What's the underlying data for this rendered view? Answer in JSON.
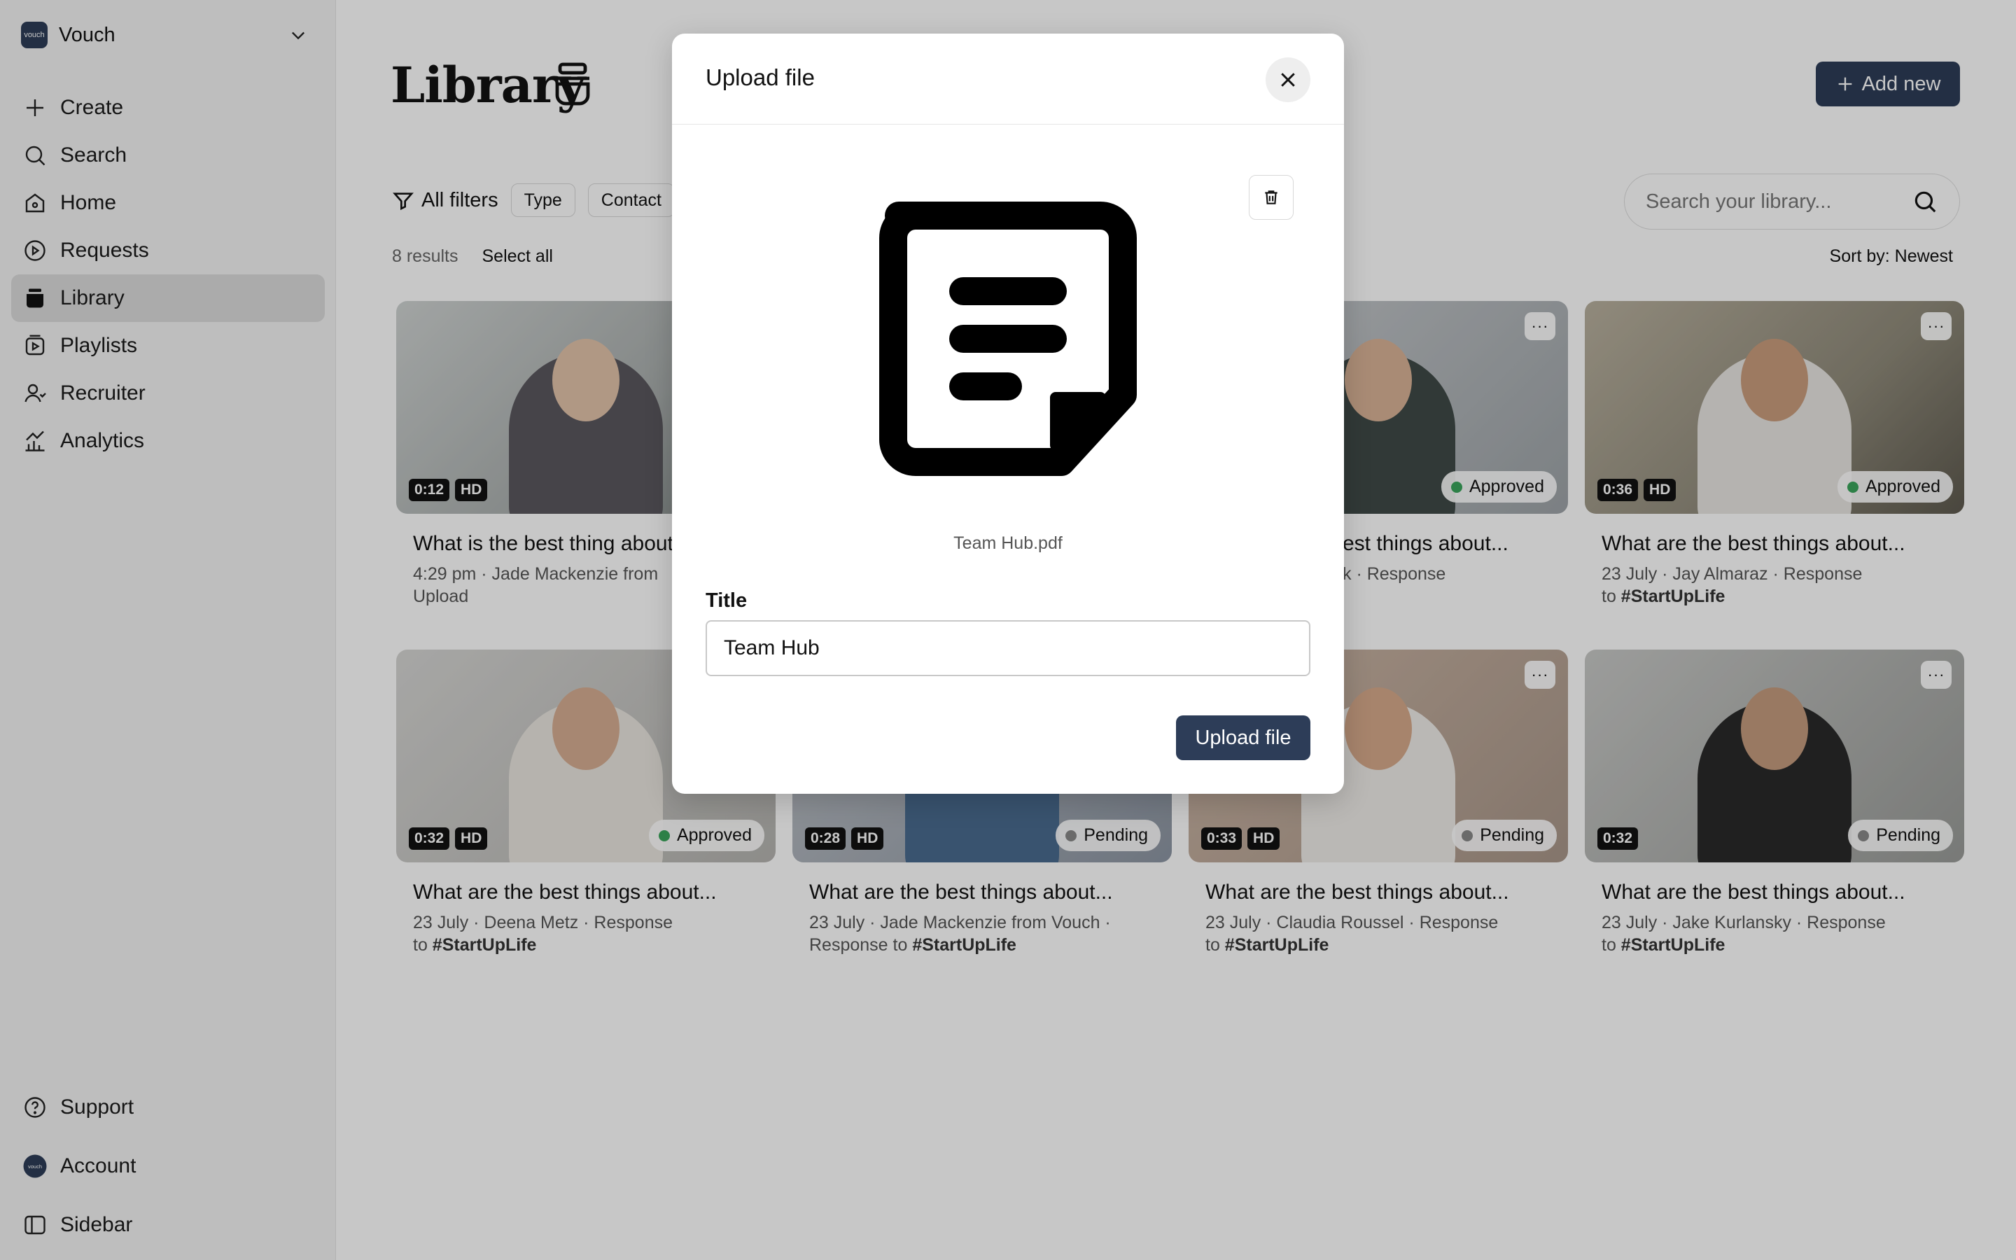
{
  "sidebar": {
    "org_logo_text": "vouch",
    "org_name": "Vouch",
    "nav": [
      {
        "label": "Create",
        "icon": "plus-icon"
      },
      {
        "label": "Search",
        "icon": "search-icon"
      },
      {
        "label": "Home",
        "icon": "home-icon"
      },
      {
        "label": "Requests",
        "icon": "play-circle-icon"
      },
      {
        "label": "Library",
        "icon": "library-icon",
        "active": true
      },
      {
        "label": "Playlists",
        "icon": "playlist-icon"
      },
      {
        "label": "Recruiter",
        "icon": "user-icon"
      },
      {
        "label": "Analytics",
        "icon": "analytics-icon"
      }
    ],
    "bottom": [
      {
        "label": "Support",
        "icon": "help-icon"
      },
      {
        "label": "Account",
        "icon": "avatar-icon"
      },
      {
        "label": "Sidebar",
        "icon": "sidebar-icon"
      }
    ]
  },
  "main": {
    "title": "Library",
    "add_new_label": "Add new",
    "all_filters_label": "All filters",
    "filter_chips": [
      "Type",
      "Contact"
    ],
    "search_placeholder": "Search your library...",
    "results_count": "8 results",
    "select_all_label": "Select all",
    "sort_label": "Sort by: Newest",
    "cards": [
      {
        "duration": "0:12",
        "hd": "HD",
        "status": "",
        "status_color": "#3aa55c",
        "title": "What is the best thing about",
        "meta": "4:29 pm · Jade Mackenzie from",
        "meta2": "Upload",
        "tag": ""
      },
      {
        "duration": "",
        "hd": "",
        "status": "",
        "status_color": "",
        "title": "",
        "meta": "",
        "meta2": "",
        "tag": ""
      },
      {
        "duration": "",
        "hd": "",
        "status": "Approved",
        "status_color": "#3aa55c",
        "title": "est things about...",
        "meta": "k · Response",
        "meta2": "",
        "tag": ""
      },
      {
        "duration": "0:36",
        "hd": "HD",
        "status": "Approved",
        "status_color": "#3aa55c",
        "title": "What are the best things about...",
        "meta": "23 July · Jay Almaraz · Response",
        "meta2": "to ",
        "tag": "#StartUpLife"
      },
      {
        "duration": "0:32",
        "hd": "HD",
        "status": "Approved",
        "status_color": "#3aa55c",
        "title": "What are the best things about...",
        "meta": "23 July · Deena Metz · Response",
        "meta2": "to ",
        "tag": "#StartUpLife"
      },
      {
        "duration": "0:28",
        "hd": "HD",
        "status": "Pending",
        "status_color": "#888888",
        "title": "What are the best things about...",
        "meta": "23 July · Jade Mackenzie from Vouch ·",
        "meta2": "Response to ",
        "tag": "#StartUpLife"
      },
      {
        "duration": "0:33",
        "hd": "HD",
        "status": "Pending",
        "status_color": "#888888",
        "title": "What are the best things about...",
        "meta": "23 July · Claudia Roussel · Response",
        "meta2": "to ",
        "tag": "#StartUpLife"
      },
      {
        "duration": "0:32",
        "hd": "",
        "status": "Pending",
        "status_color": "#888888",
        "title": "What are the best things about...",
        "meta": "23 July · Jake Kurlansky · Response",
        "meta2": "to ",
        "tag": "#StartUpLife"
      }
    ]
  },
  "dialog": {
    "title": "Upload file",
    "file_name": "Team Hub.pdf",
    "title_label": "Title",
    "title_value": "Team Hub",
    "upload_button_label": "Upload file"
  },
  "colors": {
    "accent": "#2d3d58",
    "approved": "#3aa55c",
    "pending": "#888888"
  }
}
